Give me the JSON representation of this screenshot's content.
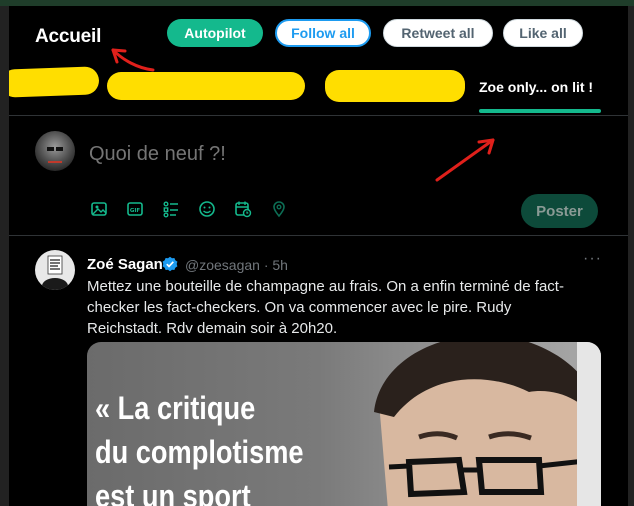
{
  "header": {
    "title": "Accueil",
    "buttons": {
      "autopilot": "Autopilot",
      "follow_all": "Follow all",
      "retweet_all": "Retweet all",
      "like_all": "Like all"
    }
  },
  "tabs": {
    "active_label": "Zoe only... on lit !"
  },
  "compose": {
    "placeholder": "Quoi de neuf ?!",
    "post_label": "Poster",
    "tools": [
      "image-icon",
      "gif-icon",
      "poll-icon",
      "emoji-icon",
      "schedule-icon",
      "location-icon"
    ]
  },
  "tweet": {
    "author": "Zoé Sagan",
    "handle_time": "@zoesagan · 5h",
    "more": "···",
    "text": "Mettez une bouteille de champagne au frais. On a enfin terminé de fact-checker les fact-checkers. On va commencer avec le pire. Rudy Reichstadt. Rdv demain soir à 20h20.",
    "media_lines": [
      "« La critique",
      "du complotisme",
      "est un sport"
    ]
  },
  "colors": {
    "accent": "#14b98d",
    "twitter_blue": "#1d9bf0",
    "annotation_red": "#e0201b",
    "redaction_yellow": "#ffde00"
  }
}
